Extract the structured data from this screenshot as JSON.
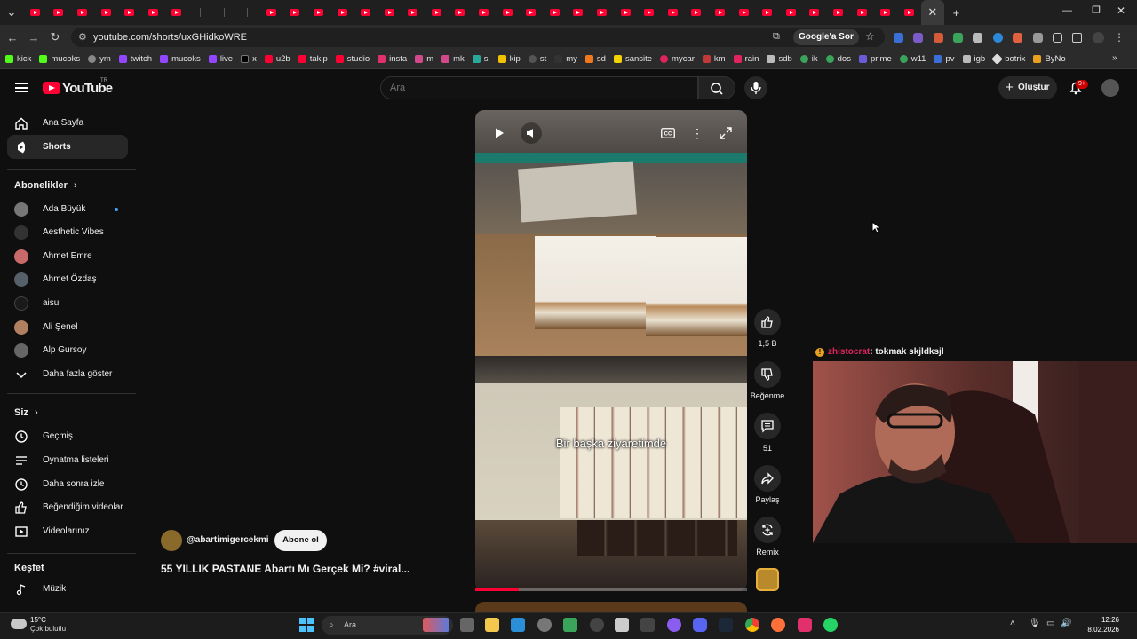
{
  "browser": {
    "url": "youtube.com/shorts/uxGHidkoWRE",
    "google_ask": "Google'a Sor",
    "bookmarks": [
      "kick",
      "mucoks",
      "ym",
      "twitch",
      "mucoks",
      "live",
      "x",
      "u2b",
      "takip",
      "studio",
      "insta",
      "m",
      "mk",
      "sl",
      "kip",
      "st",
      "my",
      "sd",
      "sansite",
      "mycar",
      "km",
      "rain",
      "sdb",
      "ik",
      "dos",
      "prime",
      "w11",
      "pv",
      "igb",
      "botrix",
      "ByNo"
    ]
  },
  "youtube": {
    "logo_text": "YouTube",
    "country": "TR",
    "search_placeholder": "Ara",
    "create_label": "Oluştur",
    "notif_badge": "9+"
  },
  "sidebar": {
    "home": "Ana Sayfa",
    "shorts": "Shorts",
    "subs_header": "Abonelikler",
    "subscriptions": [
      "Ada Büyük",
      "Aesthetic Vibes",
      "Ahmet Emre",
      "Ahmet Özdaş",
      "aisu",
      "Ali Şenel",
      "Alp Gursoy"
    ],
    "show_more": "Daha fazla göster",
    "you_header": "Siz",
    "you_items": [
      "Geçmiş",
      "Oynatma listeleri",
      "Daha sonra izle",
      "Beğendiğim videolar",
      "Videolarınız"
    ],
    "explore_header": "Keşfet",
    "explore_items": [
      "Müzik"
    ]
  },
  "short": {
    "caption": "Bir başka ziyaretimde",
    "channel": "@abartimigercekmi",
    "subscribe": "Abone ol",
    "title": "55 YILLIK PASTANE Abartı Mı Gerçek Mi? #viral...",
    "progress": 0.16,
    "likes": "1,5 B",
    "dislike": "Beğenme",
    "comments": "51",
    "share": "Paylaş",
    "remix": "Remix"
  },
  "overlay": {
    "chat_user": "zhistocrat",
    "chat_text": ": tokmak skjldksjl"
  },
  "taskbar": {
    "temp": "15°C",
    "weather": "Çok bulutlu",
    "search": "Ara",
    "time": "12:26",
    "date": "8.02.2026"
  }
}
